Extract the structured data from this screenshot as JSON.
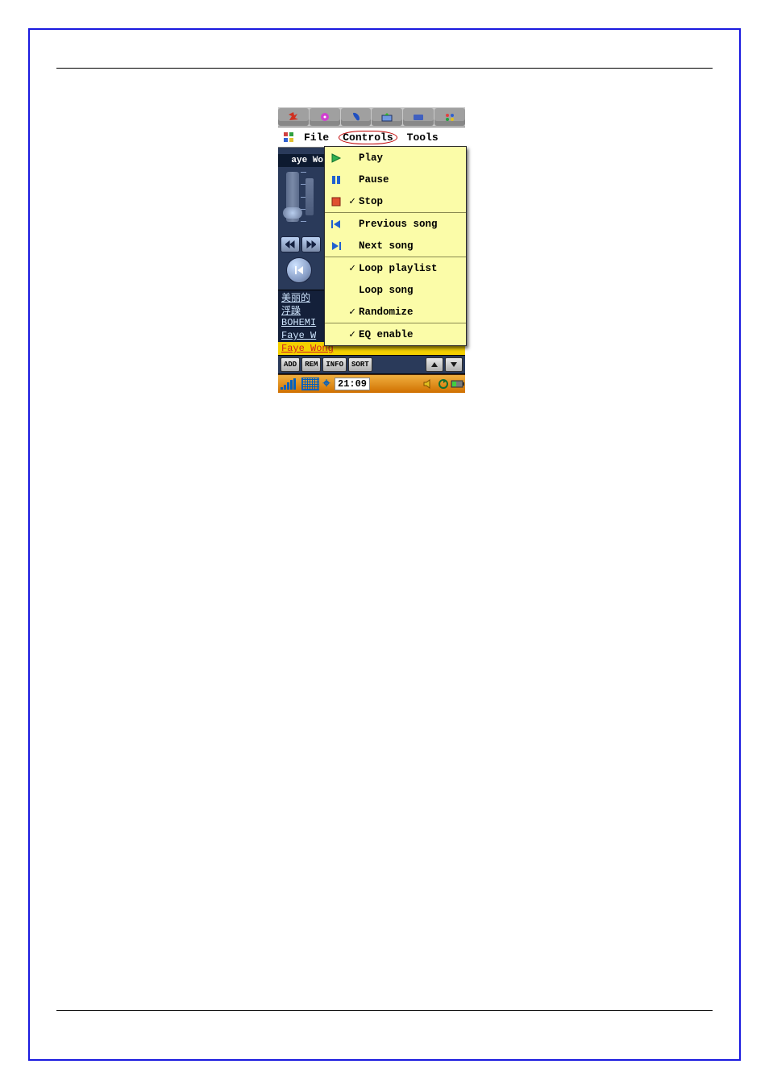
{
  "menu": {
    "file": "File",
    "controls": "Controls",
    "tools": "Tools"
  },
  "dropdown": {
    "play": "Play",
    "pause": "Pause",
    "stop": "Stop",
    "previous": "Previous song",
    "next": "Next song",
    "loop_playlist": "Loop playlist",
    "loop_song": "Loop song",
    "randomize": "Randomize",
    "eq_enable": "EQ enable"
  },
  "now_playing": "aye Wo",
  "playlist": {
    "items": [
      "美丽的",
      "浮躁",
      "BOHEMI",
      "Faye W",
      "Faye Wong"
    ]
  },
  "toolbar": {
    "add": "ADD",
    "rem": "REM",
    "info": "INFO",
    "sort": "SORT"
  },
  "clock": "21:09"
}
